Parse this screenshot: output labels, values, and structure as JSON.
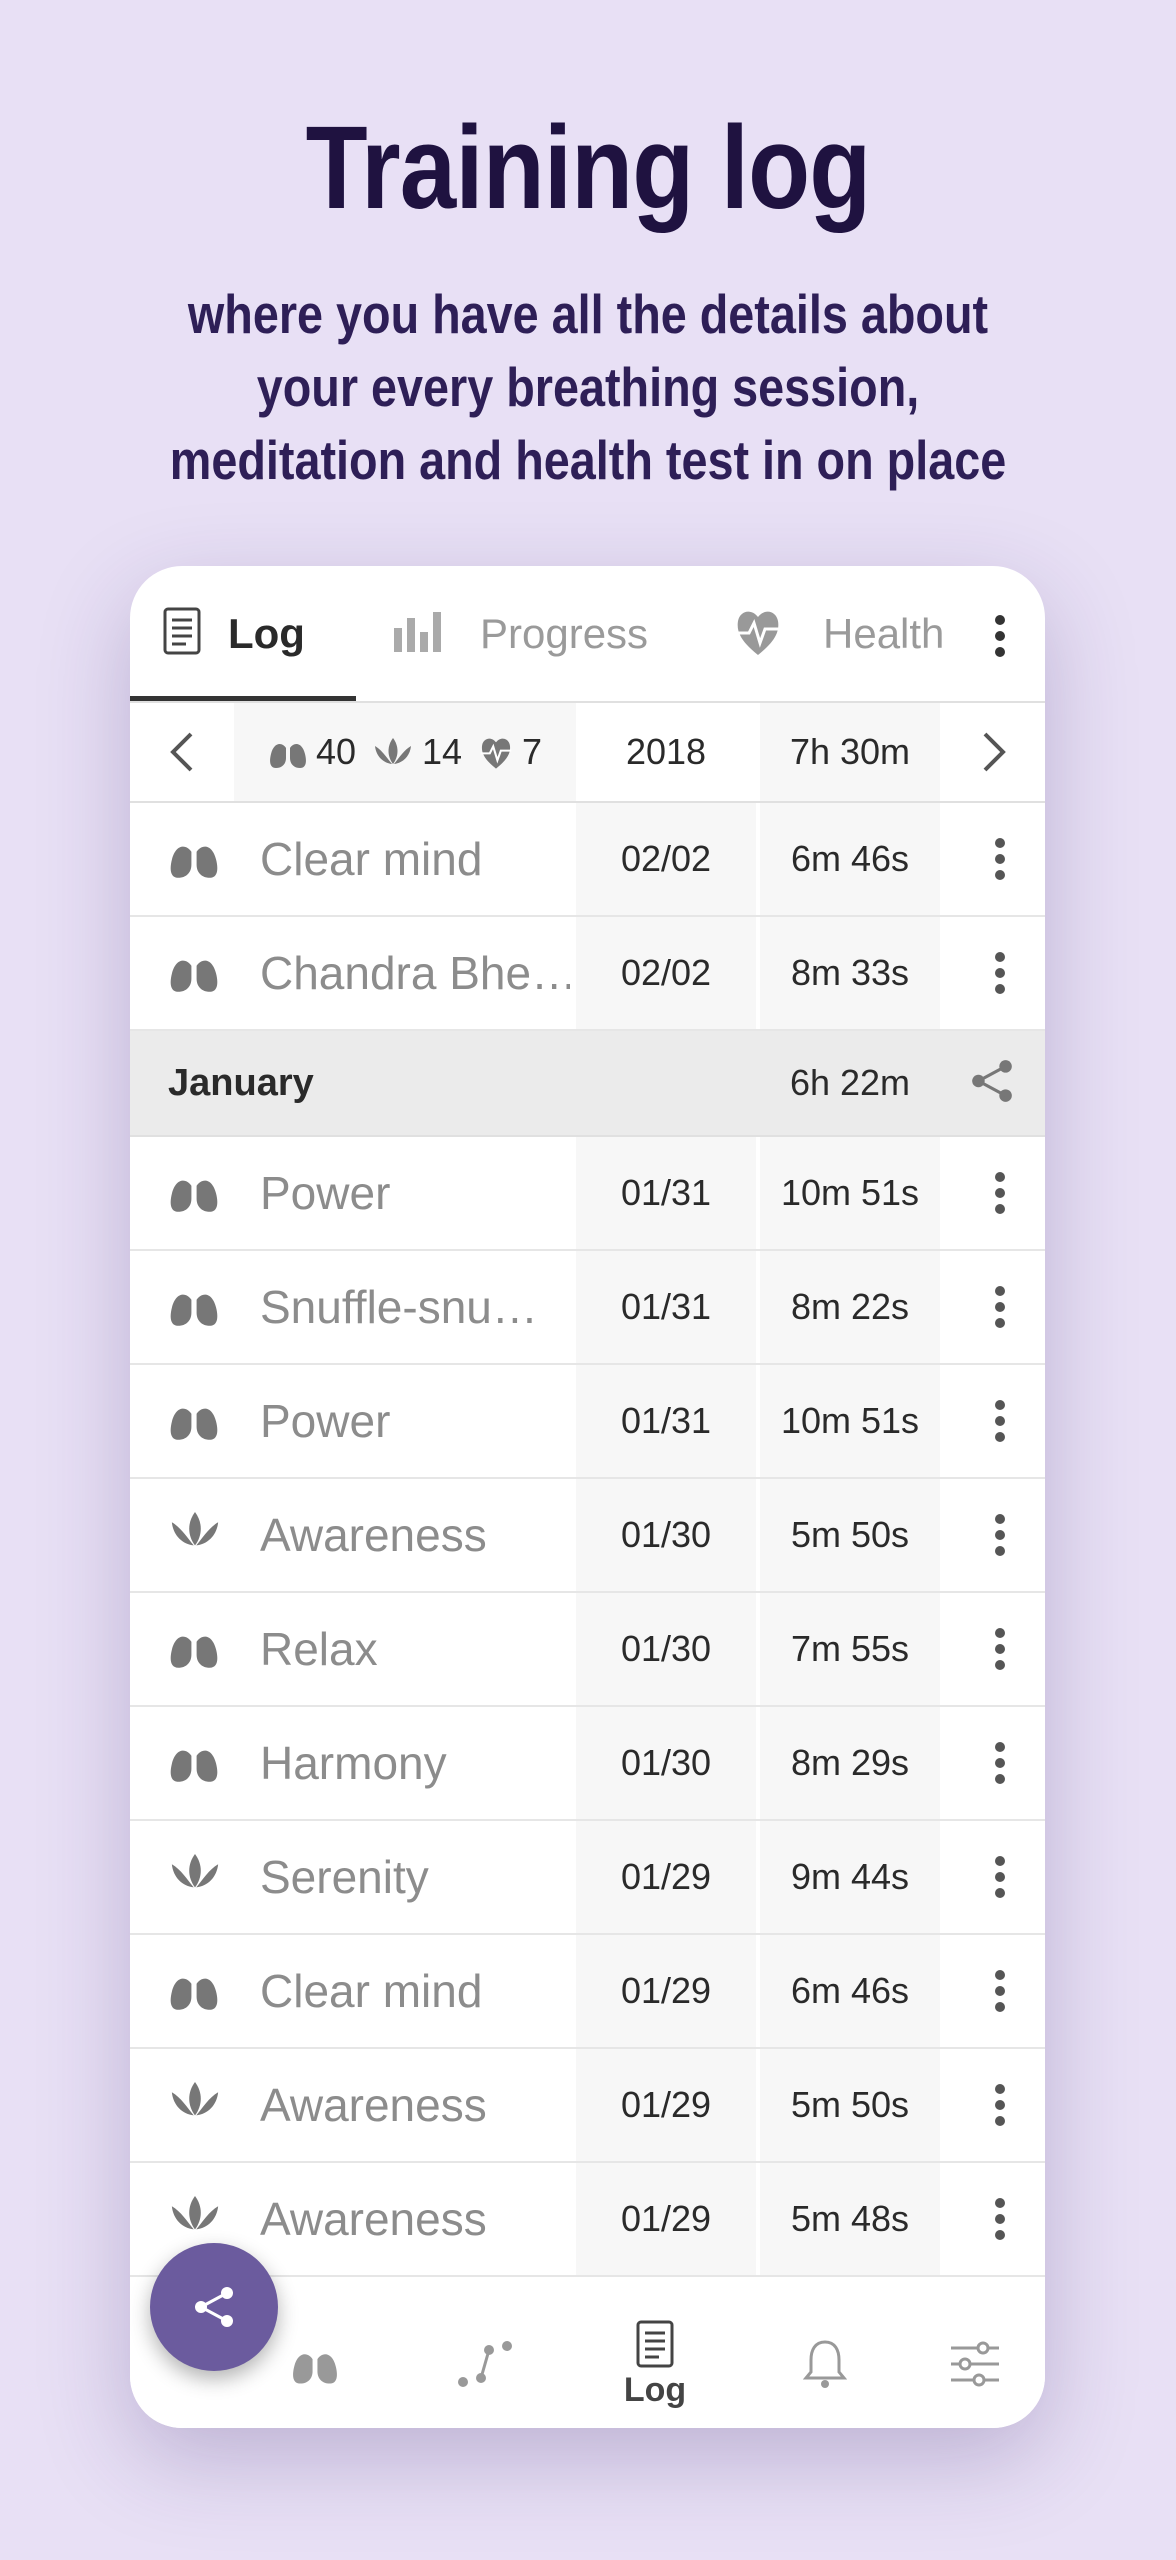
{
  "hero": {
    "title": "Training log",
    "subtitle_lines": [
      "where you have all the details about",
      "your every breathing session,",
      "meditation and health test in on place"
    ]
  },
  "tabs": [
    {
      "label": "Log",
      "icon": "log-icon",
      "active": true
    },
    {
      "label": "Progress",
      "icon": "bar-chart-icon",
      "active": false
    },
    {
      "label": "Health",
      "icon": "heart-pulse-icon",
      "active": false
    }
  ],
  "summary": {
    "breathing_count": "40",
    "meditation_count": "14",
    "health_count": "7",
    "year": "2018",
    "total": "7h 30m"
  },
  "rows_before": [
    {
      "type": "breathing",
      "name": "Clear mind",
      "date": "02/02",
      "duration": "6m 46s"
    },
    {
      "type": "breathing",
      "name": "Chandra Bhe…",
      "date": "02/02",
      "duration": "8m 33s"
    }
  ],
  "month": {
    "name": "January",
    "total": "6h 22m"
  },
  "rows_after": [
    {
      "type": "breathing",
      "name": "Power",
      "date": "01/31",
      "duration": "10m 51s"
    },
    {
      "type": "breathing",
      "name": "Snuffle-snu…",
      "date": "01/31",
      "duration": "8m 22s"
    },
    {
      "type": "breathing",
      "name": "Power",
      "date": "01/31",
      "duration": "10m 51s"
    },
    {
      "type": "meditation",
      "name": "Awareness",
      "date": "01/30",
      "duration": "5m 50s"
    },
    {
      "type": "breathing",
      "name": "Relax",
      "date": "01/30",
      "duration": "7m 55s"
    },
    {
      "type": "breathing",
      "name": "Harmony",
      "date": "01/30",
      "duration": "8m 29s"
    },
    {
      "type": "meditation",
      "name": "Serenity",
      "date": "01/29",
      "duration": "9m 44s"
    },
    {
      "type": "breathing",
      "name": "Clear mind",
      "date": "01/29",
      "duration": "6m 46s"
    },
    {
      "type": "meditation",
      "name": "Awareness",
      "date": "01/29",
      "duration": "5m 50s"
    },
    {
      "type": "meditation",
      "name": "Awareness",
      "date": "01/29",
      "duration": "5m 48s"
    }
  ],
  "bottom_nav": [
    {
      "icon": "lungs-icon",
      "label": ""
    },
    {
      "icon": "route-icon",
      "label": ""
    },
    {
      "icon": "log-icon",
      "label": "Log",
      "active": true
    },
    {
      "icon": "bell-icon",
      "label": ""
    },
    {
      "icon": "sliders-icon",
      "label": ""
    }
  ],
  "colors": {
    "background": "#e8e0f5",
    "title": "#1f1240",
    "fab": "#6b5b9e",
    "icon_gray": "#7a7a7a"
  }
}
